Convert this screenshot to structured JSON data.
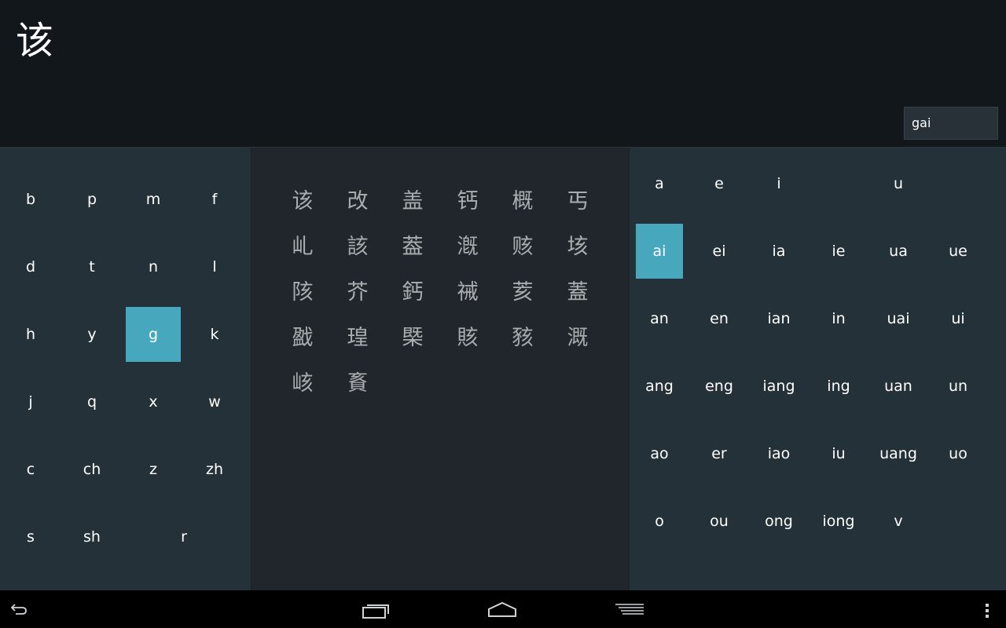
{
  "header": {
    "selected_char": "该",
    "pinyin": "gai"
  },
  "initials": [
    {
      "label": "b",
      "name": "initial-b"
    },
    {
      "label": "p",
      "name": "initial-p"
    },
    {
      "label": "m",
      "name": "initial-m"
    },
    {
      "label": "f",
      "name": "initial-f"
    },
    {
      "label": "d",
      "name": "initial-d"
    },
    {
      "label": "t",
      "name": "initial-t"
    },
    {
      "label": "n",
      "name": "initial-n"
    },
    {
      "label": "l",
      "name": "initial-l"
    },
    {
      "label": "h",
      "name": "initial-h"
    },
    {
      "label": "y",
      "name": "initial-y"
    },
    {
      "label": "g",
      "name": "initial-g",
      "selected": true
    },
    {
      "label": "k",
      "name": "initial-k"
    },
    {
      "label": "j",
      "name": "initial-j"
    },
    {
      "label": "q",
      "name": "initial-q"
    },
    {
      "label": "x",
      "name": "initial-x"
    },
    {
      "label": "w",
      "name": "initial-w"
    },
    {
      "label": "c",
      "name": "initial-c"
    },
    {
      "label": "ch",
      "name": "initial-ch"
    },
    {
      "label": "z",
      "name": "initial-z"
    },
    {
      "label": "zh",
      "name": "initial-zh"
    },
    {
      "label": "s",
      "name": "initial-s"
    },
    {
      "label": "sh",
      "name": "initial-sh"
    },
    {
      "label": "r",
      "name": "initial-r"
    }
  ],
  "characters": [
    "该",
    "改",
    "盖",
    "钙",
    "概",
    "丐",
    "乢",
    "該",
    "葢",
    "漑",
    "赅",
    "垓",
    "陔",
    "芥",
    "鈣",
    "祴",
    "荄",
    "蓋",
    "戤",
    "瑝",
    "槩",
    "賅",
    "豥",
    "溉",
    "峐",
    "賌"
  ],
  "finals": [
    [
      "a",
      "e",
      "i",
      "",
      "u",
      ""
    ],
    [
      "ai",
      "ei",
      "ia",
      "ie",
      "ua",
      "ue"
    ],
    [
      "an",
      "en",
      "ian",
      "in",
      "uai",
      "ui"
    ],
    [
      "ang",
      "eng",
      "iang",
      "ing",
      "uan",
      "un"
    ],
    [
      "ao",
      "er",
      "iao",
      "iu",
      "uang",
      "uo"
    ],
    [
      "o",
      "ou",
      "ong",
      "iong",
      "v",
      ""
    ]
  ],
  "selected_final": "ai",
  "colors": {
    "accent": "#47a8bd",
    "panel": "#253139",
    "middle_panel": "#20262b",
    "header": "#12171b",
    "char_text": "#a9adb0"
  },
  "navbar": {
    "icons": [
      "back-icon",
      "recent-apps-icon",
      "home-icon",
      "menu-lines-icon",
      "overflow-menu-icon"
    ]
  }
}
